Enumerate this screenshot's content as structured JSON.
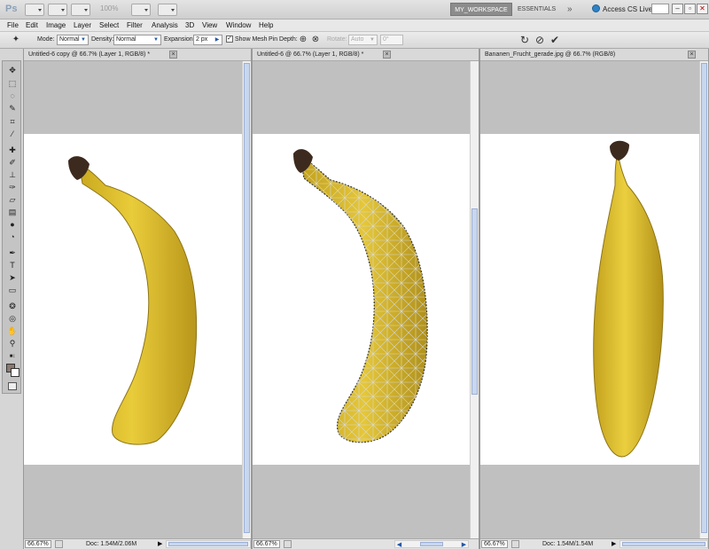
{
  "app": {
    "logo": "Ps",
    "zoom_readout": "100%",
    "workspace": "MY_WORKSPACE",
    "essentials": "ESSENTIALS",
    "more": "»",
    "access_live": "Access CS Live"
  },
  "menu": [
    "File",
    "Edit",
    "Image",
    "Layer",
    "Select",
    "Filter",
    "Analysis",
    "3D",
    "View",
    "Window",
    "Help"
  ],
  "options": {
    "mode_label": "Mode:",
    "mode_value": "Normal",
    "density_label": "Density:",
    "density_value": "Normal",
    "expansion_label": "Expansion:",
    "expansion_value": "2 px",
    "show_mesh_label": "Show Mesh",
    "show_mesh_checked": true,
    "pin_depth_label": "Pin Depth:",
    "rotate_label": "Rotate:",
    "rotate_value": "Auto",
    "rotate_degrees": "0°"
  },
  "documents": [
    {
      "title": "Untitled-6 copy @ 66.7% (Layer 1, RGB/8) *",
      "zoom": "66.67%",
      "doc_info": "Doc: 1.54M/2.06M"
    },
    {
      "title": "Untitled-6 @ 66.7% (Layer 1, RGB/8) *",
      "zoom": "66.67%",
      "doc_info": ""
    },
    {
      "title": "Bananen_Frucht_gerade.jpg @ 66.7% (RGB/8)",
      "zoom": "66.67%",
      "doc_info": "Doc: 1.54M/1.54M"
    }
  ],
  "colors": {
    "foreground": "#8b7a6e",
    "background": "#ffffff",
    "banana_yellow": "#e3c431",
    "banana_shadow": "#a8891a",
    "stem": "#3d2a1e",
    "mesh": "#d8dce4"
  }
}
